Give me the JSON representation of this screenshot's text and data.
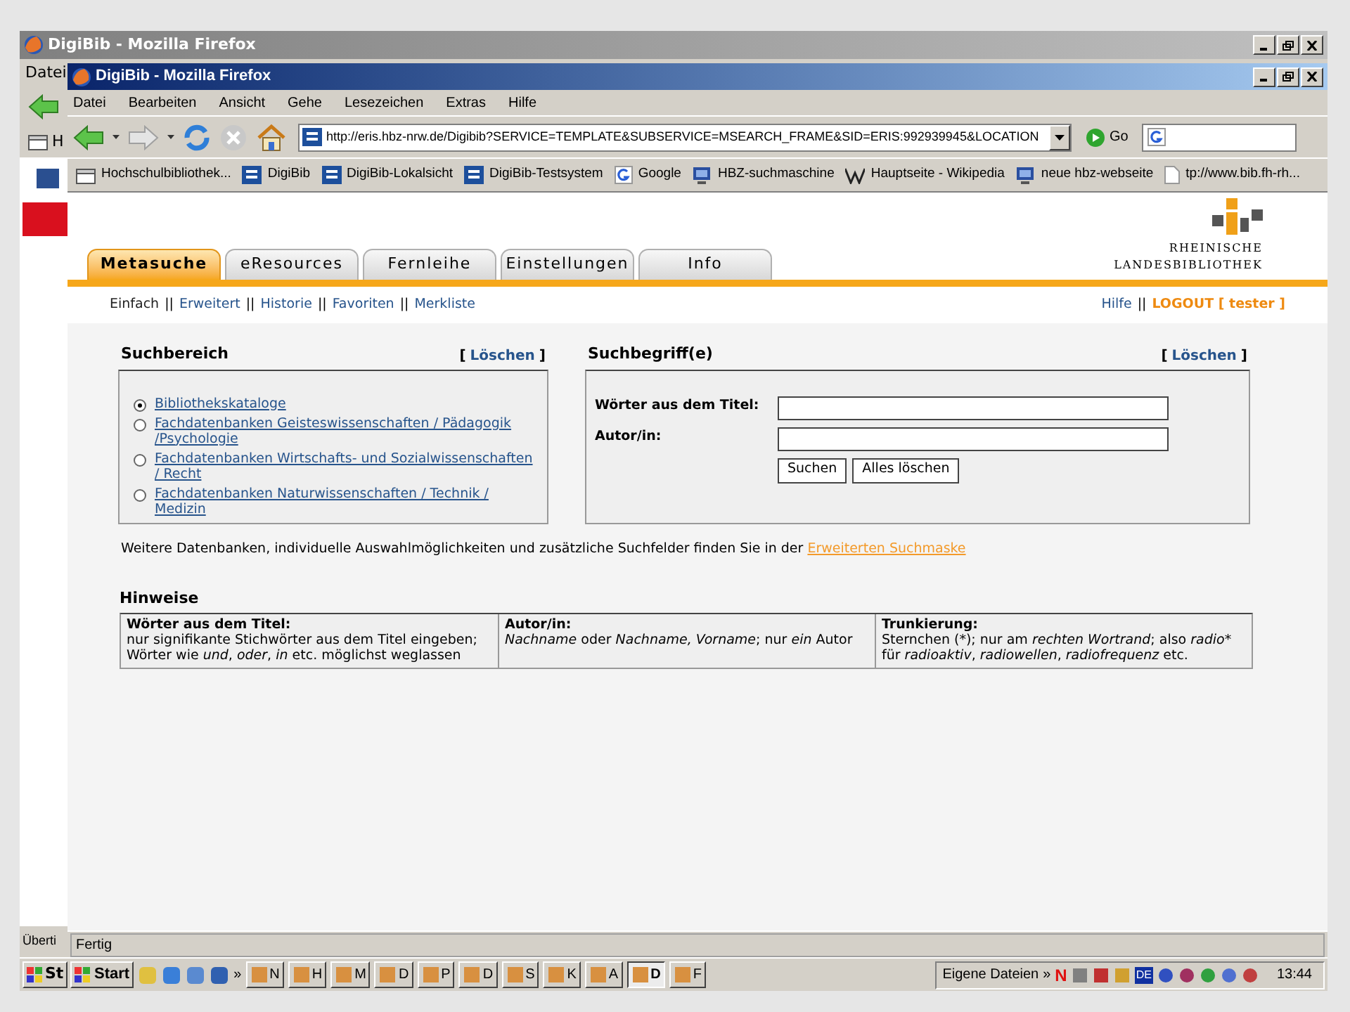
{
  "back_window": {
    "title": "DigiBib - Mozilla Firefox",
    "menu": [
      "Datei"
    ],
    "bookmark": "H",
    "status": "Überti",
    "start": "St"
  },
  "window": {
    "title": "DigiBib - Mozilla Firefox"
  },
  "menu": [
    "Datei",
    "Bearbeiten",
    "Ansicht",
    "Gehe",
    "Lesezeichen",
    "Extras",
    "Hilfe"
  ],
  "address": {
    "value": "http://eris.hbz-nrw.de/Digibib?SERVICE=TEMPLATE&SUBSERVICE=MSEARCH_FRAME&SID=ERIS:992939945&LOCATION"
  },
  "go": "Go",
  "bookmarks": [
    {
      "label": "Hochschulbibliothek...",
      "kind": "folder"
    },
    {
      "label": "DigiBib",
      "kind": "site"
    },
    {
      "label": "DigiBib-Lokalsicht",
      "kind": "site"
    },
    {
      "label": "DigiBib-Testsystem",
      "kind": "site"
    },
    {
      "label": "Google",
      "kind": "google"
    },
    {
      "label": "HBZ-suchmaschine",
      "kind": "screen"
    },
    {
      "label": "Hauptseite - Wikipedia",
      "kind": "wiki"
    },
    {
      "label": "neue hbz-webseite",
      "kind": "screen"
    },
    {
      "label": "tp://www.bib.fh-rh...",
      "kind": "page"
    }
  ],
  "logo": {
    "line1": "RHEINISCHE",
    "line2": "LANDESBIBLIOTHEK"
  },
  "tabs": [
    {
      "label": "Metasuche",
      "selected": true
    },
    {
      "label": "eResources",
      "selected": false
    },
    {
      "label": "Fernleihe",
      "selected": false
    },
    {
      "label": "Einstellungen",
      "selected": false
    },
    {
      "label": "Info",
      "selected": false
    }
  ],
  "subnav": [
    {
      "kind": "link",
      "label": "Einfach",
      "selected": true
    },
    {
      "kind": "sep",
      "label": "||"
    },
    {
      "kind": "link",
      "label": "Erweitert",
      "selected": false
    },
    {
      "kind": "sep",
      "label": "||"
    },
    {
      "kind": "link",
      "label": "Historie",
      "selected": false
    },
    {
      "kind": "sep",
      "label": "||"
    },
    {
      "kind": "link",
      "label": "Favoriten",
      "selected": false
    },
    {
      "kind": "sep",
      "label": "||"
    },
    {
      "kind": "link",
      "label": "Merkliste",
      "selected": false
    }
  ],
  "subnav_right": [
    {
      "kind": "link",
      "label": "Hilfe"
    },
    {
      "kind": "sep",
      "label": "||"
    },
    {
      "kind": "logout",
      "label": "LOGOUT [ tester ]"
    }
  ],
  "search_area": {
    "title": "Suchbereich",
    "bracket_open": "[",
    "clear": "Löschen",
    "bracket_close": "]",
    "options": [
      {
        "label": "Bibliothekskataloge",
        "selected": true
      },
      {
        "label": "Fachdatenbanken Geisteswissenschaften / Pädagogik /Psychologie",
        "selected": false
      },
      {
        "label": "Fachdatenbanken Wirtschafts- und Sozialwissenschaften / Recht",
        "selected": false
      },
      {
        "label": "Fachdatenbanken Naturwissenschaften / Technik / Medizin",
        "selected": false
      }
    ]
  },
  "search_terms": {
    "title": "Suchbegriff(e)",
    "bracket_open": "[",
    "clear": "Löschen",
    "bracket_close": "]",
    "fields": [
      {
        "label": "Wörter aus dem Titel:"
      },
      {
        "label": "Autor/in:"
      }
    ],
    "buttons": [
      "Suchen",
      "Alles löschen"
    ]
  },
  "more_note": {
    "text": "Weitere Datenbanken, individuelle Auswahlmöglichkeiten und zusätzliche Suchfelder finden Sie in der",
    "link": "Erweiterten Suchmaske"
  },
  "hints": {
    "title": "Hinweise",
    "columns": [
      {
        "heading": "Wörter aus dem Titel:",
        "segments": [
          {
            "text": "nur signifikante Stichwörter aus dem Titel eingeben; Wörter wie ",
            "italic": false
          },
          {
            "text": "und",
            "italic": true
          },
          {
            "text": ", ",
            "italic": false
          },
          {
            "text": "oder",
            "italic": true
          },
          {
            "text": ", ",
            "italic": false
          },
          {
            "text": "in",
            "italic": true
          },
          {
            "text": " etc. möglichst weglassen",
            "italic": false
          }
        ]
      },
      {
        "heading": "Autor/in:",
        "segments": [
          {
            "text": "Nachname",
            "italic": true
          },
          {
            "text": " oder ",
            "italic": false
          },
          {
            "text": "Nachname, Vorname",
            "italic": true
          },
          {
            "text": "; nur ",
            "italic": false
          },
          {
            "text": "ein",
            "italic": true
          },
          {
            "text": " Autor",
            "italic": false
          }
        ]
      },
      {
        "heading": "Trunkierung:",
        "segments": [
          {
            "text": "Sternchen (*); nur am ",
            "italic": false
          },
          {
            "text": "rechten Wortrand",
            "italic": true
          },
          {
            "text": "; also ",
            "italic": false
          },
          {
            "text": "radio*",
            "italic": true
          },
          {
            "text": " für ",
            "italic": false
          },
          {
            "text": "radioaktiv",
            "italic": true
          },
          {
            "text": ", ",
            "italic": false
          },
          {
            "text": "radiowellen",
            "italic": true
          },
          {
            "text": ", ",
            "italic": false
          },
          {
            "text": "radiofrequenz",
            "italic": true
          },
          {
            "text": " etc.",
            "italic": false
          }
        ]
      }
    ]
  },
  "status_bar": "Fertig",
  "taskbar": {
    "start": "Start",
    "more": "»",
    "tasks": [
      {
        "label": "N",
        "selected": false
      },
      {
        "label": "H",
        "selected": false
      },
      {
        "label": "M",
        "selected": false
      },
      {
        "label": "D",
        "selected": false
      },
      {
        "label": "P",
        "selected": false
      },
      {
        "label": "D",
        "selected": false
      },
      {
        "label": "S",
        "selected": false
      },
      {
        "label": "K",
        "selected": false
      },
      {
        "label": "A",
        "selected": false
      },
      {
        "label": "D",
        "selected": true
      },
      {
        "label": "F",
        "selected": false
      }
    ],
    "folder": "Eigene Dateien",
    "folder_more": "»",
    "tray_n": "N",
    "tray_lang": "DE",
    "clock": "13:44"
  }
}
